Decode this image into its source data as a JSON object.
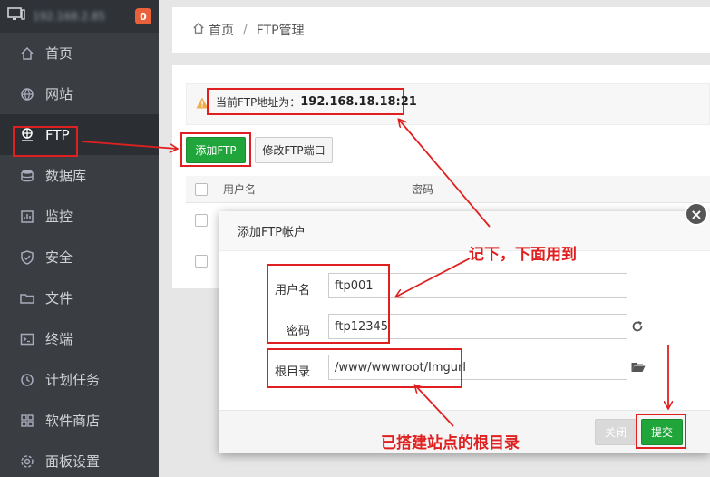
{
  "sidebar": {
    "ip_label": "192.168.2.85",
    "badge_count": "0",
    "items": [
      {
        "label": "首页",
        "icon": "home-icon"
      },
      {
        "label": "网站",
        "icon": "globe-icon"
      },
      {
        "label": "FTP",
        "icon": "ftp-icon"
      },
      {
        "label": "数据库",
        "icon": "database-icon"
      },
      {
        "label": "监控",
        "icon": "monitor-icon"
      },
      {
        "label": "安全",
        "icon": "shield-icon"
      },
      {
        "label": "文件",
        "icon": "folder-icon"
      },
      {
        "label": "终端",
        "icon": "terminal-icon"
      },
      {
        "label": "计划任务",
        "icon": "clock-icon"
      },
      {
        "label": "软件商店",
        "icon": "store-icon"
      },
      {
        "label": "面板设置",
        "icon": "gear-icon"
      }
    ]
  },
  "breadcrumb": {
    "home": "首页",
    "separator": "/",
    "current": "FTP管理"
  },
  "notice": {
    "label": "当前FTP地址为：",
    "address": "192.168.18.18:21"
  },
  "toolbar": {
    "add_label": "添加FTP",
    "port_label": "修改FTP端口"
  },
  "table": {
    "col_user": "用户名",
    "col_password": "密码"
  },
  "modal": {
    "title": "添加FTP帐户",
    "username_label": "用户名",
    "username_value": "ftp001",
    "password_label": "密码",
    "password_value": "ftp12345",
    "root_label": "根目录",
    "root_value": "/www/wwwroot/Imgurl",
    "close_label": "关闭",
    "submit_label": "提交"
  },
  "annotations": {
    "remember": "记下，下面用到",
    "root_note": "已搭建站点的根目录"
  },
  "colors": {
    "accent_green": "#20a53a",
    "annotation_red": "#e02020",
    "sidebar_bg": "#3a3e43"
  }
}
